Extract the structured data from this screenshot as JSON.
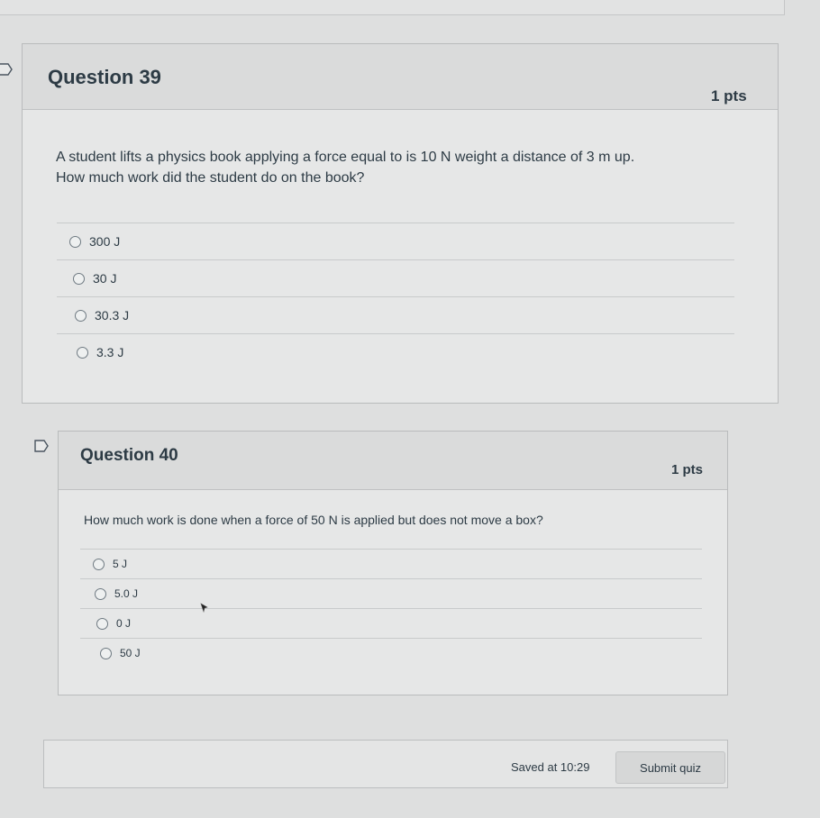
{
  "questions": [
    {
      "title": "Question 39",
      "points": "1 pts",
      "text_line1": "A student lifts a physics book applying a force equal to is 10 N weight a distance of 3 m up.",
      "text_line2": "How much work did the student do on the book?",
      "answers": [
        "300 J",
        "30 J",
        "30.3 J",
        "3.3 J"
      ]
    },
    {
      "title": "Question 40",
      "points": "1 pts",
      "text_line1": "How much work is done when a force of 50 N is applied but does not move a box?",
      "answers": [
        "5 J",
        "5.0 J",
        "0 J",
        "50 J"
      ]
    }
  ],
  "footer": {
    "saved_text": "Saved at 10:29",
    "submit_label": "Submit quiz"
  },
  "icons": {
    "flag": "flag-icon",
    "cursor": "mouse-pointer-icon"
  }
}
